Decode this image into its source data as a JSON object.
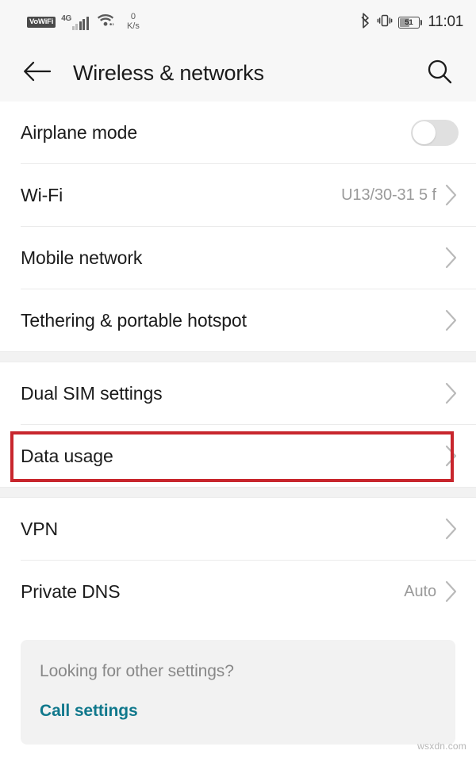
{
  "status_bar": {
    "vowifi_label": "VoWiFi",
    "network_type": "4G",
    "signal_bars": 5,
    "signal_active_bars": 3,
    "wifi_icon": "wifi-icon",
    "data_speed_value": "0",
    "data_speed_unit": "K/s",
    "bluetooth_icon": "bluetooth-icon",
    "vibrate_icon": "vibrate-icon",
    "battery_percent": "51",
    "time": "11:01"
  },
  "app_bar": {
    "back_icon": "back-arrow-icon",
    "title": "Wireless & networks",
    "search_icon": "search-icon"
  },
  "groups": [
    {
      "rows": [
        {
          "label": "Airplane mode",
          "control": "toggle",
          "toggle_on": false
        },
        {
          "label": "Wi-Fi",
          "value": "U13/30-31 5 f",
          "control": "chevron"
        },
        {
          "label": "Mobile network",
          "value": "",
          "control": "chevron"
        },
        {
          "label": "Tethering & portable hotspot",
          "value": "",
          "control": "chevron"
        }
      ]
    },
    {
      "rows": [
        {
          "label": "Dual SIM settings",
          "value": "",
          "control": "chevron"
        },
        {
          "label": "Data usage",
          "value": "",
          "control": "chevron",
          "highlighted": true
        }
      ]
    },
    {
      "rows": [
        {
          "label": "VPN",
          "value": "",
          "control": "chevron"
        },
        {
          "label": "Private DNS",
          "value": "Auto",
          "control": "chevron"
        }
      ]
    }
  ],
  "footer": {
    "question": "Looking for other settings?",
    "link": "Call settings"
  },
  "watermark": "wsxdn.com",
  "colors": {
    "highlight": "#c8262d",
    "link": "#10788c",
    "bg": "#ffffff",
    "bar_bg": "#f7f7f7",
    "divider": "#eaeaea",
    "muted_text": "#9a9a9a"
  }
}
